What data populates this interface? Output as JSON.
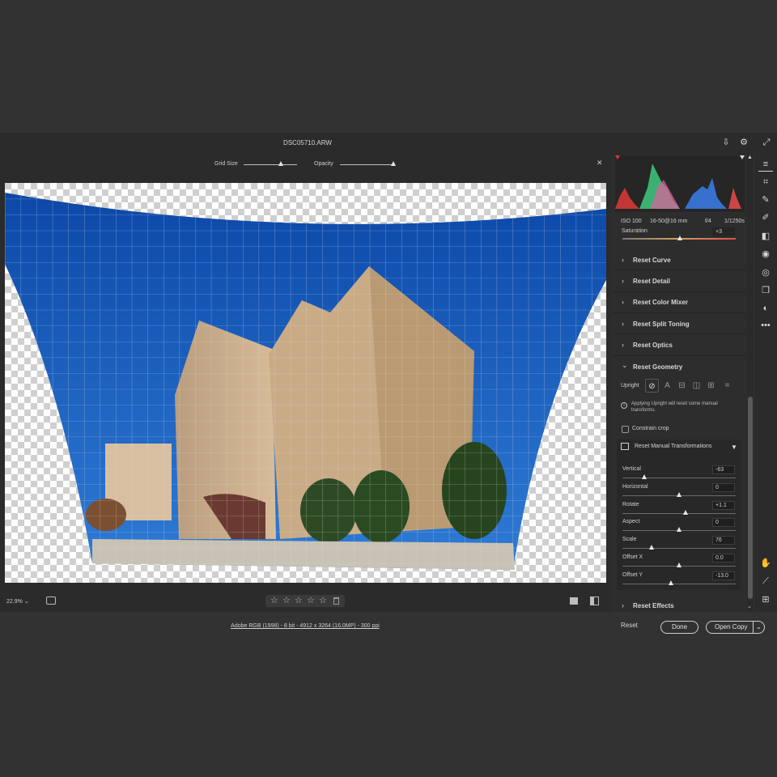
{
  "window": {
    "title": "DSC05710.ARW"
  },
  "overlay": {
    "grid_size_label": "Grid Size",
    "opacity_label": "Opacity",
    "grid_size": 0.7,
    "opacity": 0.95
  },
  "bottom": {
    "zoom": "22.9%",
    "zoom_caret": "⌄",
    "rating_stars": [
      "☆",
      "☆",
      "☆",
      "☆",
      "☆"
    ],
    "trash_icon": "trash-icon"
  },
  "footer": {
    "info_link": "Adobe RGB (1998) - 8 bit - 4912 x 3264 (16.0MP) - 300 ppi",
    "reset": "Reset",
    "done": "Done",
    "open_copy": "Open Copy",
    "caret": "⌄"
  },
  "histogram": {
    "iso": "ISO 100",
    "lens": "16-50@16 mm",
    "aperture": "f/4",
    "shutter": "1/1250s"
  },
  "saturation": {
    "label": "Saturation",
    "value": "+3"
  },
  "sections": [
    {
      "label": "Reset Curve",
      "chevron": "›"
    },
    {
      "label": "Reset Detail",
      "chevron": "›"
    },
    {
      "label": "Reset Color Mixer",
      "chevron": "›"
    },
    {
      "label": "Reset Split Toning",
      "chevron": "›"
    },
    {
      "label": "Reset Optics",
      "chevron": "›"
    },
    {
      "label": "Reset Geometry",
      "chevron": "⌄"
    }
  ],
  "geometry": {
    "upright_label": "Upright",
    "info_text": "Applying Upright will reset some manual transforms.",
    "constrain_crop": "Constrain crop",
    "manual_title": "Reset Manual Transformations",
    "rows": [
      {
        "label": "Vertical",
        "value": "-63",
        "level": 0.19
      },
      {
        "label": "Horizontal",
        "value": "0",
        "level": 0.5
      },
      {
        "label": "Rotate",
        "value": "+1.1",
        "level": 0.56
      },
      {
        "label": "Aspect",
        "value": "0",
        "level": 0.5
      },
      {
        "label": "Scale",
        "value": "76",
        "level": 0.26
      },
      {
        "label": "Offset X",
        "value": "0.0",
        "level": 0.5
      },
      {
        "label": "Offset Y",
        "value": "-13.0",
        "level": 0.43
      }
    ]
  },
  "effects": {
    "label": "Reset Effects",
    "chevron": "›"
  },
  "tools": [
    "sliders-icon",
    "crop-icon",
    "heal-icon",
    "brush-icon",
    "gradient-icon",
    "radial-icon",
    "redeye-icon",
    "presets-icon",
    "snapshot-icon",
    "more-icon",
    "hand-icon",
    "eyedropper-icon",
    "grid-icon"
  ]
}
